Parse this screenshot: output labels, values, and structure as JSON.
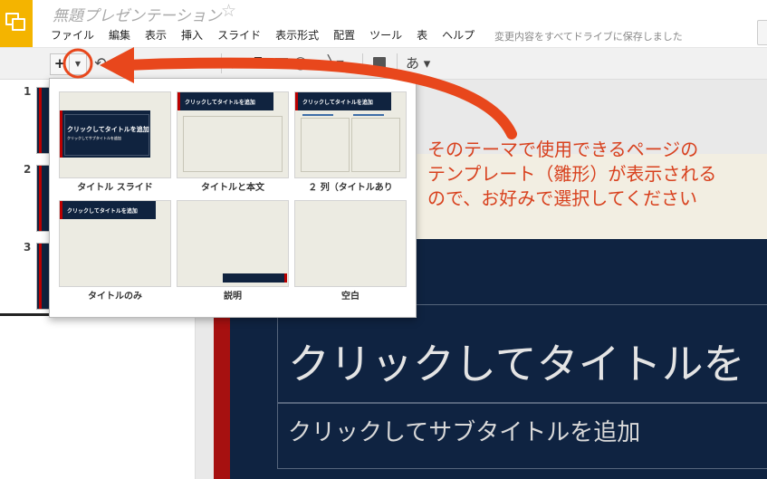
{
  "app": {
    "doc_title": "無題プレゼンテーション",
    "star_glyph": "☆",
    "save_status": "変更内容をすべてドライブに保存しました"
  },
  "menu": [
    "ファイル",
    "編集",
    "表示",
    "挿入",
    "スライド",
    "表示形式",
    "配置",
    "ツール",
    "表",
    "ヘルプ"
  ],
  "toolbar": {
    "add_label": "+",
    "dropdown_glyph": "▼",
    "undo_glyph": "↶",
    "cursor_glyph": "▶",
    "textbox_glyph": "T",
    "shape_glyph": "◯▾",
    "line_glyph": "╲▾",
    "font_label": "あ ▾"
  },
  "filmstrip": {
    "slides": [
      "1",
      "2",
      "3"
    ]
  },
  "layouts": [
    {
      "label": "タイトル スライド",
      "thumb_text": "クリックしてタイトルを追加",
      "thumb_sub": "クリックしてサブタイトルを追加"
    },
    {
      "label": "タイトルと本文",
      "thumb_text": "クリックしてタイトルを追加"
    },
    {
      "label": "２ 列（タイトルあり",
      "thumb_text": "クリックしてタイトルを追加"
    },
    {
      "label": "タイトルのみ",
      "thumb_text": "クリックしてタイトルを追加"
    },
    {
      "label": "説明",
      "thumb_text": ""
    },
    {
      "label": "空白",
      "thumb_text": ""
    }
  ],
  "slide": {
    "title": "クリックしてタイトルを",
    "subtitle": "クリックしてサブタイトルを追加"
  },
  "annotation": {
    "lines": [
      "そのテーマで使用できるページの",
      "テンプレート（雛形）が表示される",
      "ので、お好みで選択してください"
    ],
    "color": "#d8411e"
  },
  "colors": {
    "logo": "#f4b400",
    "navy": "#0f2341",
    "accent_red": "#a61010",
    "arrow": "#e8471c"
  }
}
